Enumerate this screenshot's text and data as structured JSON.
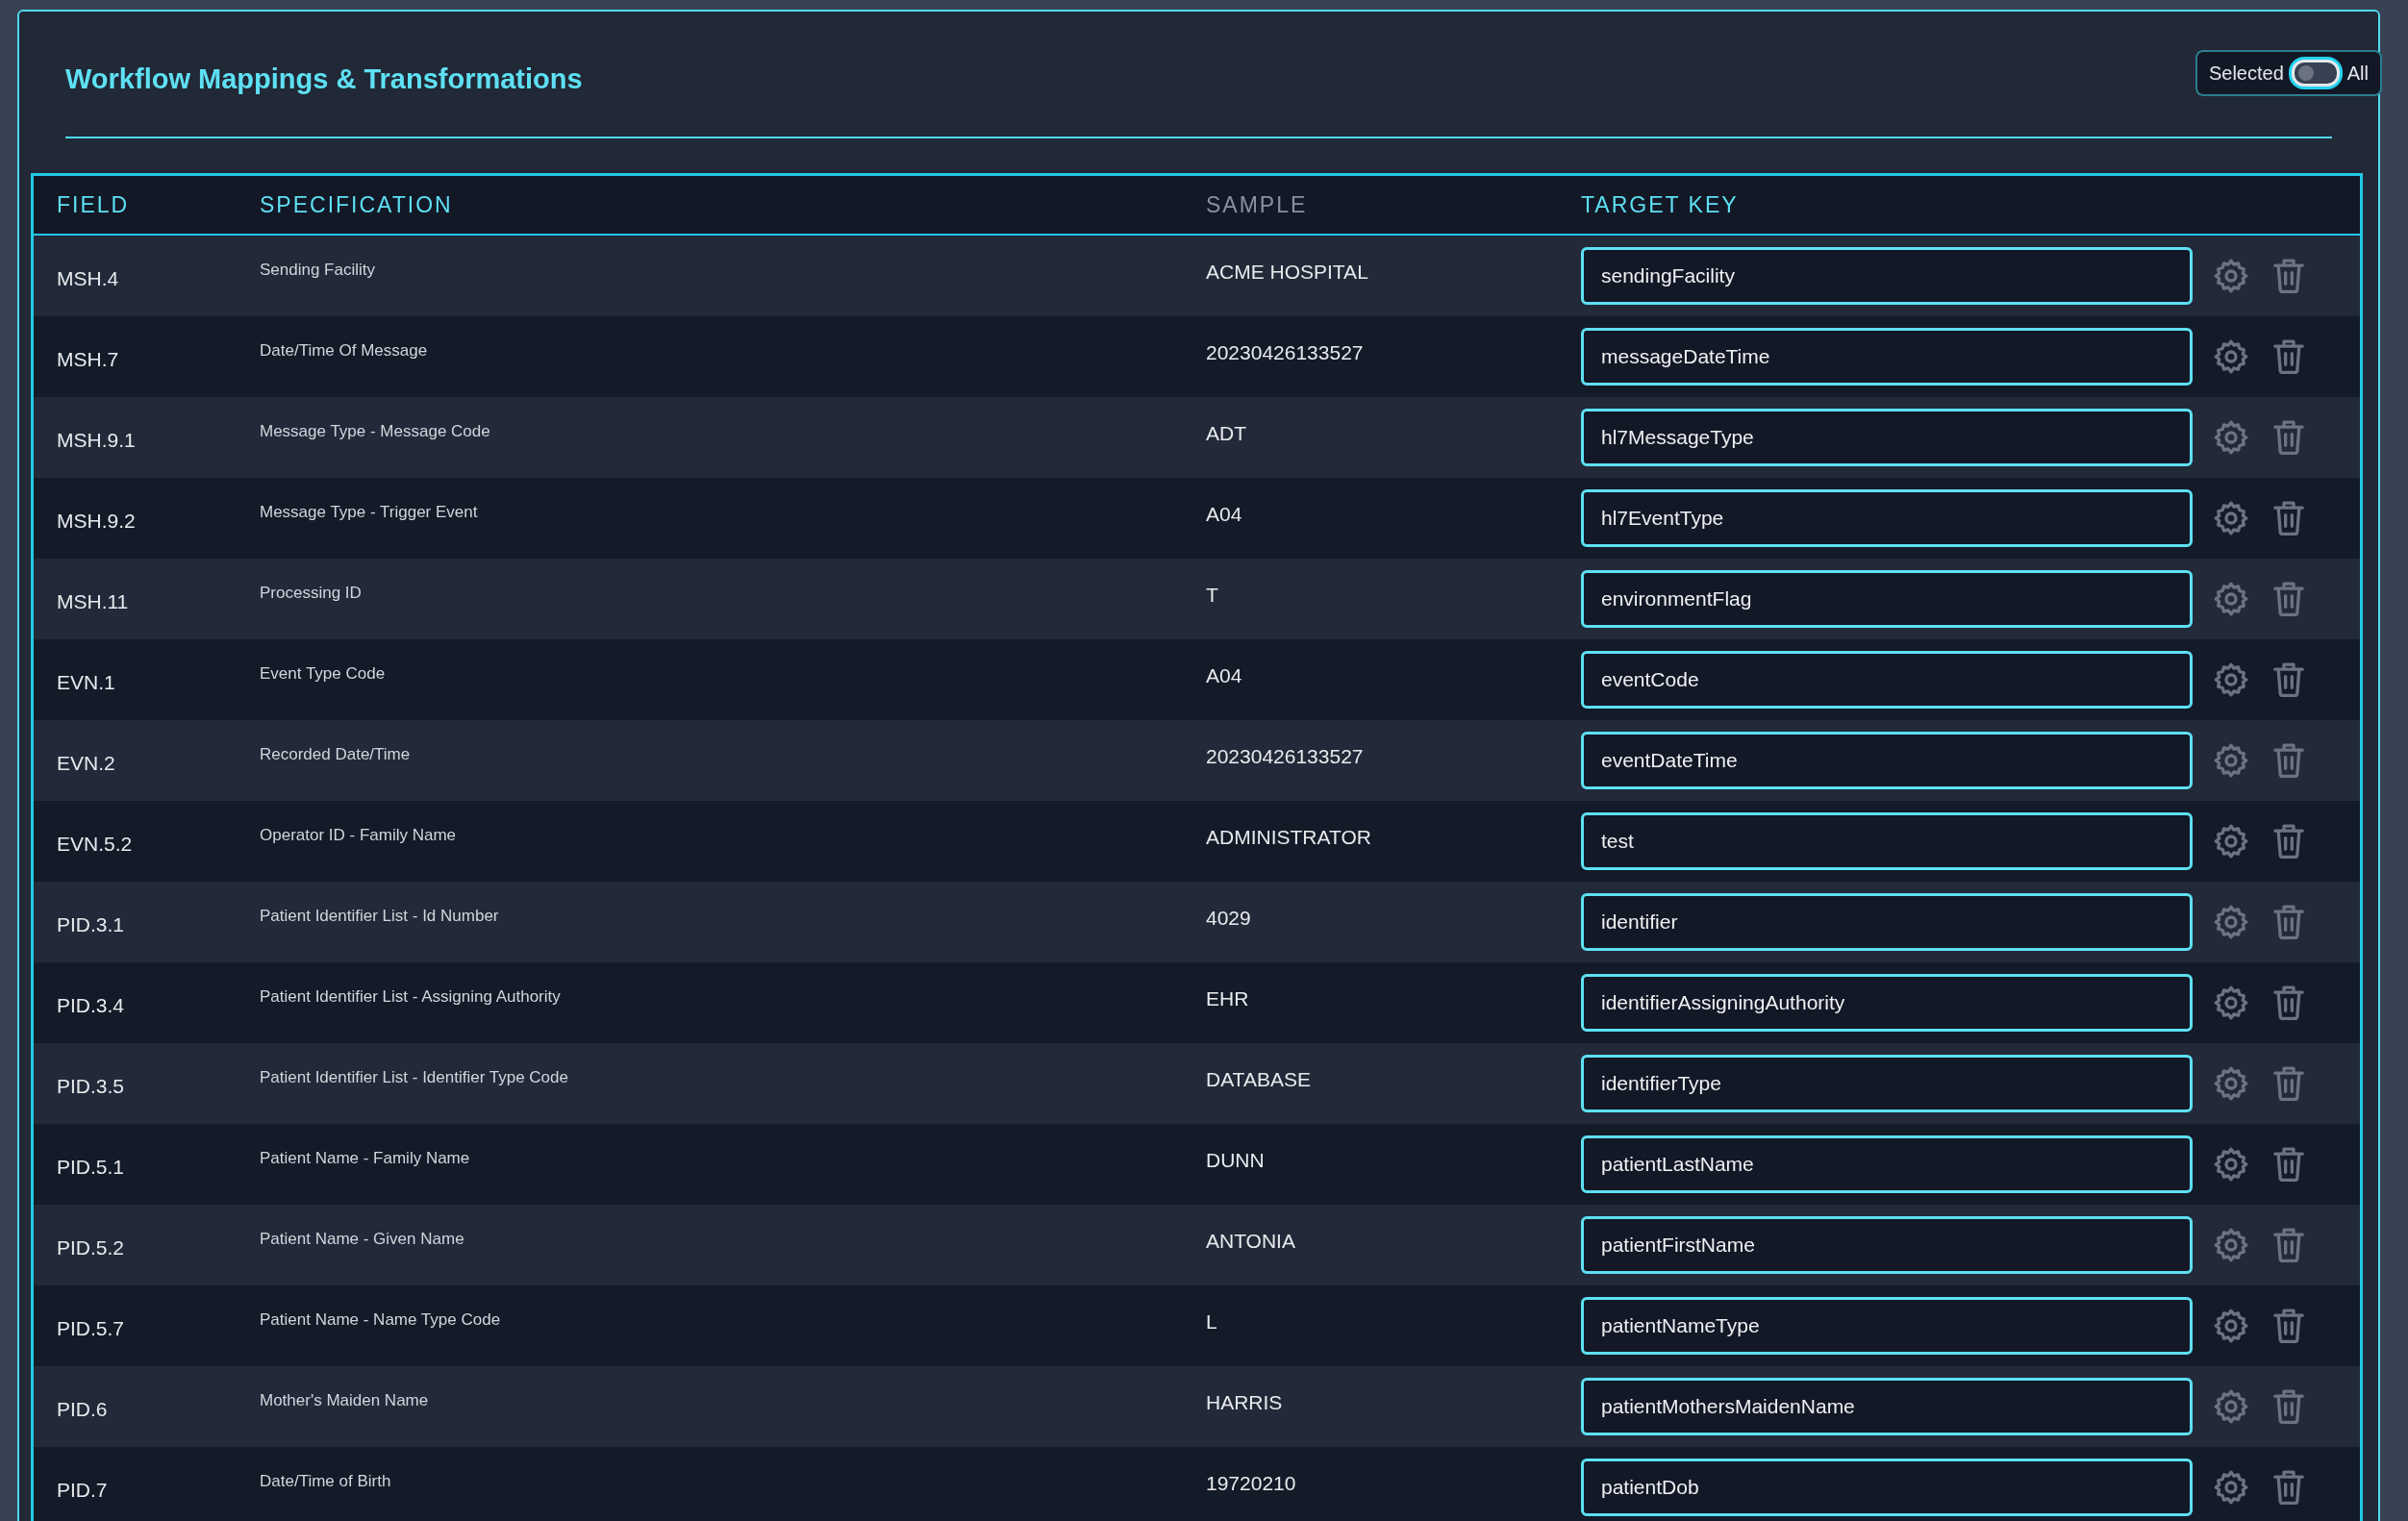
{
  "panel": {
    "title": "Workflow Mappings & Transformations",
    "filter_toggle": {
      "left_label": "Selected",
      "right_label": "All",
      "on": false
    }
  },
  "table": {
    "columns": [
      {
        "label": "FIELD",
        "muted": false
      },
      {
        "label": "SPECIFICATION",
        "muted": false
      },
      {
        "label": "SAMPLE",
        "muted": true
      },
      {
        "label": "TARGET KEY",
        "muted": false
      }
    ],
    "rows": [
      {
        "field": "MSH.4",
        "specification": "Sending Facility",
        "sample": "ACME HOSPITAL",
        "target_key": "sendingFacility"
      },
      {
        "field": "MSH.7",
        "specification": "Date/Time Of Message",
        "sample": "20230426133527",
        "target_key": "messageDateTime"
      },
      {
        "field": "MSH.9.1",
        "specification": "Message Type - Message Code",
        "sample": "ADT",
        "target_key": "hl7MessageType"
      },
      {
        "field": "MSH.9.2",
        "specification": "Message Type - Trigger Event",
        "sample": "A04",
        "target_key": "hl7EventType"
      },
      {
        "field": "MSH.11",
        "specification": "Processing ID",
        "sample": "T",
        "target_key": "environmentFlag"
      },
      {
        "field": "EVN.1",
        "specification": "Event Type Code",
        "sample": "A04",
        "target_key": "eventCode"
      },
      {
        "field": "EVN.2",
        "specification": "Recorded Date/Time",
        "sample": "20230426133527",
        "target_key": "eventDateTime"
      },
      {
        "field": "EVN.5.2",
        "specification": "Operator ID - Family Name",
        "sample": "ADMINISTRATOR",
        "target_key": "test"
      },
      {
        "field": "PID.3.1",
        "specification": "Patient Identifier List - Id Number",
        "sample": "4029",
        "target_key": "identifier"
      },
      {
        "field": "PID.3.4",
        "specification": "Patient Identifier List - Assigning Authority",
        "sample": "EHR",
        "target_key": "identifierAssigningAuthority"
      },
      {
        "field": "PID.3.5",
        "specification": "Patient Identifier List - Identifier Type Code",
        "sample": "DATABASE",
        "target_key": "identifierType"
      },
      {
        "field": "PID.5.1",
        "specification": "Patient Name - Family Name",
        "sample": "DUNN",
        "target_key": "patientLastName"
      },
      {
        "field": "PID.5.2",
        "specification": "Patient Name - Given Name",
        "sample": "ANTONIA",
        "target_key": "patientFirstName"
      },
      {
        "field": "PID.5.7",
        "specification": "Patient Name - Name Type Code",
        "sample": "L",
        "target_key": "patientNameType"
      },
      {
        "field": "PID.6",
        "specification": "Mother's Maiden Name",
        "sample": "HARRIS",
        "target_key": "patientMothersMaidenName"
      },
      {
        "field": "PID.7",
        "specification": "Date/Time of Birth",
        "sample": "19720210",
        "target_key": "patientDob"
      }
    ]
  }
}
